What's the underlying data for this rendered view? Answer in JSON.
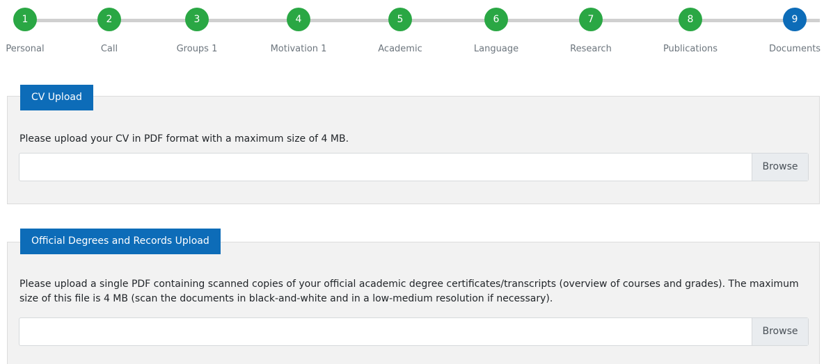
{
  "stepper": {
    "steps": [
      {
        "number": "1",
        "label": "Personal",
        "state": "done"
      },
      {
        "number": "2",
        "label": "Call",
        "state": "done"
      },
      {
        "number": "3",
        "label": "Groups 1",
        "state": "done"
      },
      {
        "number": "4",
        "label": "Motivation 1",
        "state": "done"
      },
      {
        "number": "5",
        "label": "Academic",
        "state": "done"
      },
      {
        "number": "6",
        "label": "Language",
        "state": "done"
      },
      {
        "number": "7",
        "label": "Research",
        "state": "done"
      },
      {
        "number": "8",
        "label": "Publications",
        "state": "done"
      },
      {
        "number": "9",
        "label": "Documents",
        "state": "current"
      }
    ],
    "colors": {
      "done": "#2aa744",
      "current": "#0d6cb8",
      "line": "#d0d0d0"
    }
  },
  "cv_upload": {
    "title": "CV Upload",
    "instructions": "Please upload your CV in PDF format with a maximum size of 4 MB.",
    "browse_label": "Browse"
  },
  "degrees_upload": {
    "title": "Official Degrees and Records Upload",
    "instructions": "Please upload a single PDF containing scanned copies of your official academic degree certificates/transcripts (overview of courses and grades). The maximum size of this file is 4 MB (scan the documents in black-and-white and in a low-medium resolution if necessary).",
    "browse_label": "Browse"
  }
}
